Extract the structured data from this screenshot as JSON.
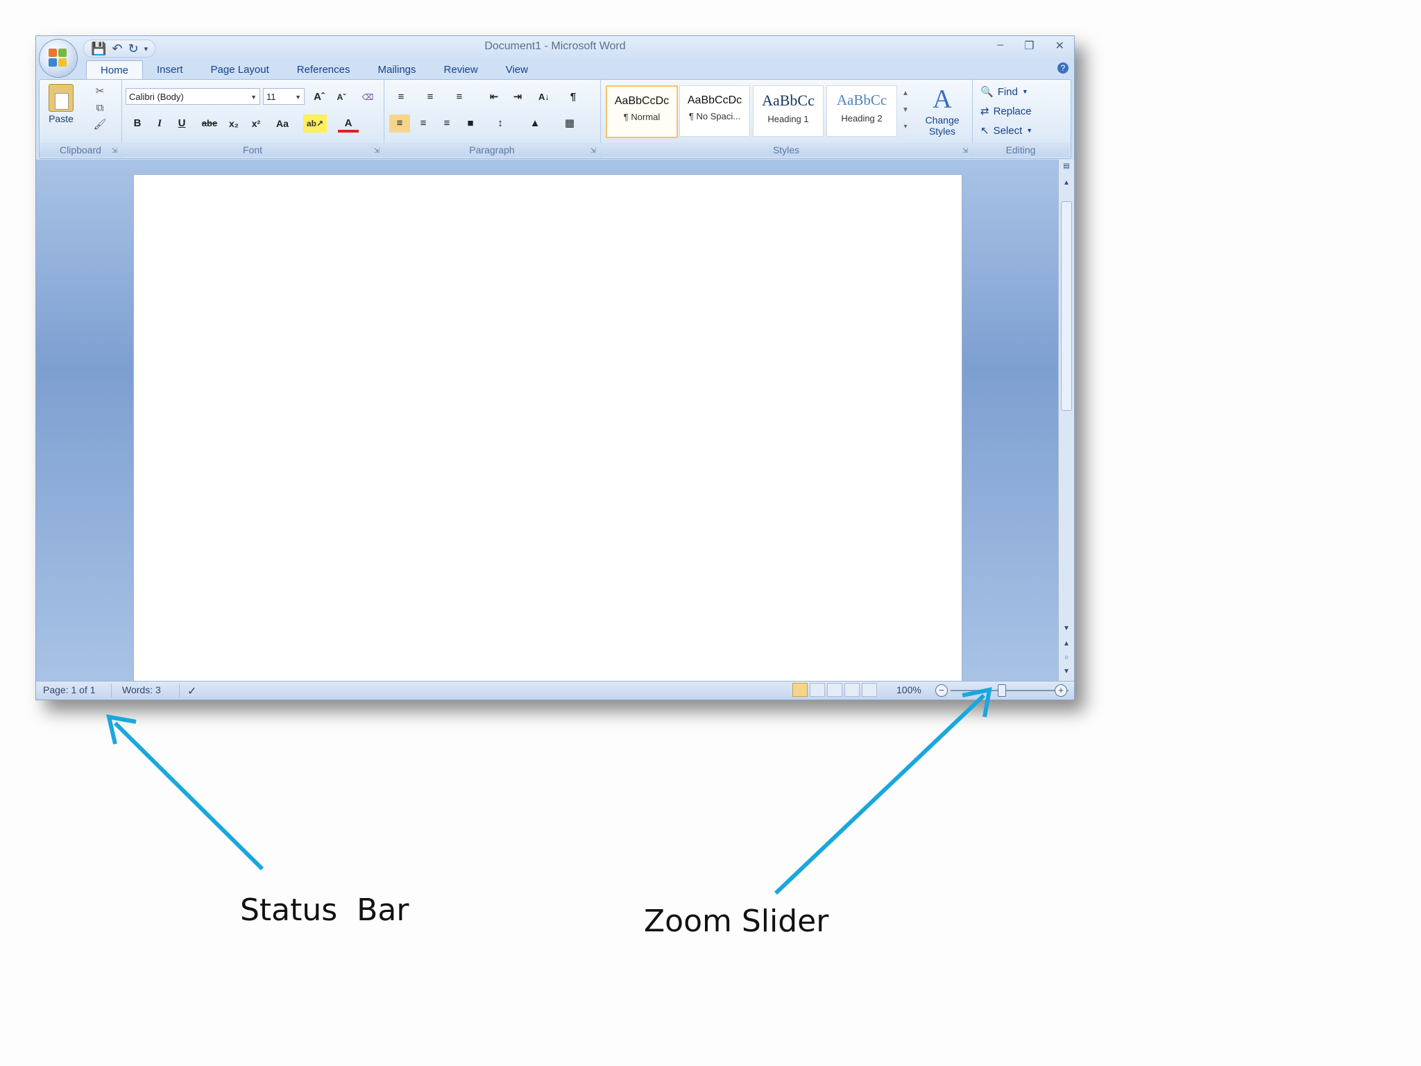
{
  "window": {
    "title": "Document1 - Microsoft Word",
    "quick_access": [
      "save-icon",
      "undo-icon",
      "redo-icon",
      "customize-icon"
    ],
    "controls": {
      "minimize": "–",
      "restore": "❐",
      "close": "✕"
    }
  },
  "tabs": [
    "Home",
    "Insert",
    "Page Layout",
    "References",
    "Mailings",
    "Review",
    "View"
  ],
  "active_tab": "Home",
  "ribbon": {
    "clipboard": {
      "label": "Clipboard",
      "paste_label": "Paste"
    },
    "font": {
      "label": "Font",
      "font_name": "Calibri (Body)",
      "font_size": "11",
      "bold": "B",
      "italic": "I",
      "underline": "U",
      "strikethrough": "abe",
      "subscript": "x₂",
      "superscript": "x²",
      "change_case": "Aa"
    },
    "paragraph": {
      "label": "Paragraph"
    },
    "styles": {
      "label": "Styles",
      "items": [
        {
          "sample": "AaBbCcDc",
          "name": "¶ Normal",
          "selected": true
        },
        {
          "sample": "AaBbCcDc",
          "name": "¶ No Spaci...",
          "selected": false
        },
        {
          "sample": "AaBbCc",
          "name": "Heading 1",
          "selected": false
        },
        {
          "sample": "AaBbCc",
          "name": "Heading 2",
          "selected": false
        }
      ],
      "change_styles": "Change Styles"
    },
    "editing": {
      "label": "Editing",
      "find": "Find",
      "replace": "Replace",
      "select": "Select"
    }
  },
  "status_bar": {
    "page": "Page: 1 of 1",
    "words": "Words: 3",
    "zoom": "100%",
    "zoom_level_percent": 100
  },
  "annotations": {
    "status_bar": "Status  Bar",
    "zoom_slider": "Zoom Slider"
  },
  "colors": {
    "arrow": "#1aa7dd",
    "ribbon_text": "#15428b",
    "selected_style_border": "#f2c46a"
  }
}
